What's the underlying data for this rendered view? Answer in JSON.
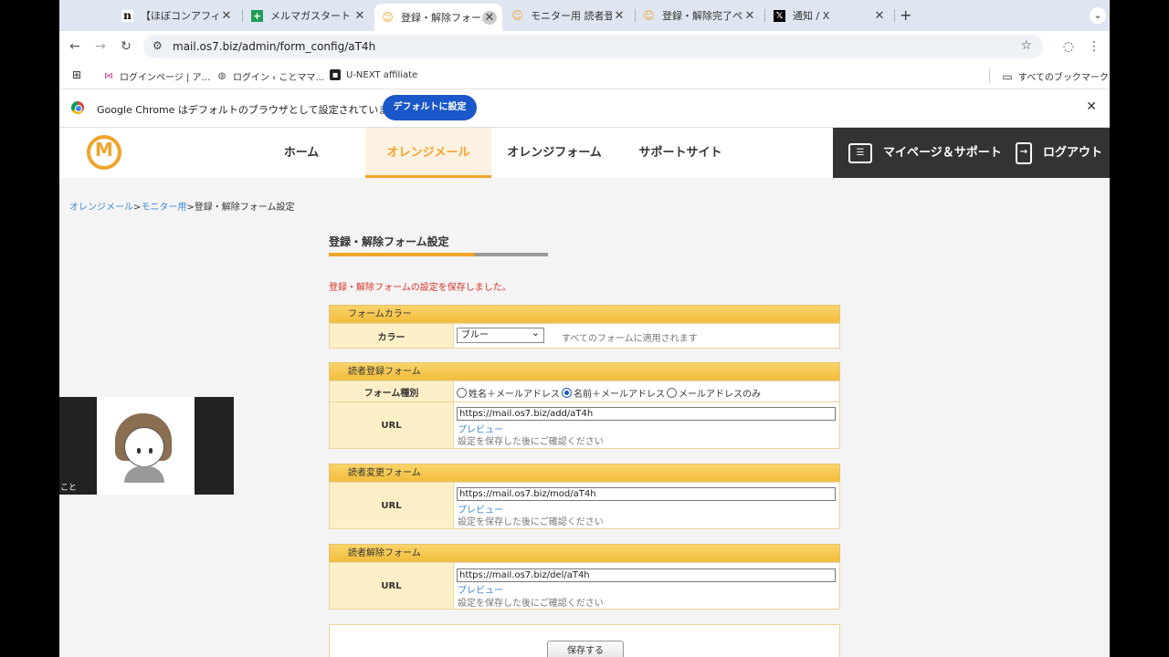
{
  "tabs": [
    {
      "favicon": "n",
      "title": "【ほぼコンアフィリ…"
    },
    {
      "favicon": "sheet",
      "title": "メルマガスタートま…"
    },
    {
      "favicon": "orange",
      "title": "登録・解除フォーム…",
      "active": true
    },
    {
      "favicon": "orange",
      "title": "モニター用 読者登録"
    },
    {
      "favicon": "orange",
      "title": "登録・解除完了ペー…"
    },
    {
      "favicon": "x",
      "title": "通知 / X"
    }
  ],
  "address": {
    "url": "mail.os7.biz/admin/form_config/aT4h"
  },
  "bookmarks": [
    {
      "label": "ログインページ | ア…"
    },
    {
      "label": "ログイン ‹ ことママ…"
    },
    {
      "label": "U-NEXT affiliate"
    }
  ],
  "bookmarks_all": "すべてのブックマーク",
  "infobar": {
    "text": "Google Chrome はデフォルトのブラウザとして設定されていません",
    "button": "デフォルトに設定"
  },
  "site_nav": {
    "home": "ホーム",
    "orange_mail": "オレンジメール",
    "orange_form": "オレンジフォーム",
    "support": "サポートサイト",
    "mypage": "マイページ＆サポート",
    "logout": "ログアウト"
  },
  "breadcrumb": {
    "crumb1": "オレンジメール",
    "crumb2": "モニター用",
    "current": "登録・解除フォーム設定",
    "sep": ">"
  },
  "page": {
    "title": "登録・解除フォーム設定",
    "saved_message": "登録・解除フォームの設定を保存しました。"
  },
  "form_color": {
    "header": "フォームカラー",
    "label": "カラー",
    "selected": "ブルー",
    "note": "すべてのフォームに適用されます"
  },
  "register_form": {
    "header": "読者登録フォーム",
    "type_label": "フォーム種別",
    "options": [
      "姓名＋メールアドレス",
      "名前＋メールアドレス",
      "メールアドレスのみ"
    ],
    "url_label": "URL",
    "url": "https://mail.os7.biz/add/aT4h",
    "preview": "プレビュー",
    "note": "設定を保存した後にご確認ください"
  },
  "change_form": {
    "header": "読者変更フォーム",
    "url_label": "URL",
    "url": "https://mail.os7.biz/mod/aT4h",
    "preview": "プレビュー",
    "note": "設定を保存した後にご確認ください"
  },
  "cancel_form": {
    "header": "読者解除フォーム",
    "url_label": "URL",
    "url": "https://mail.os7.biz/del/aT4h",
    "preview": "プレビュー",
    "note": "設定を保存した後にご確認ください"
  },
  "save_button": "保存する",
  "webcam_label": "こと"
}
